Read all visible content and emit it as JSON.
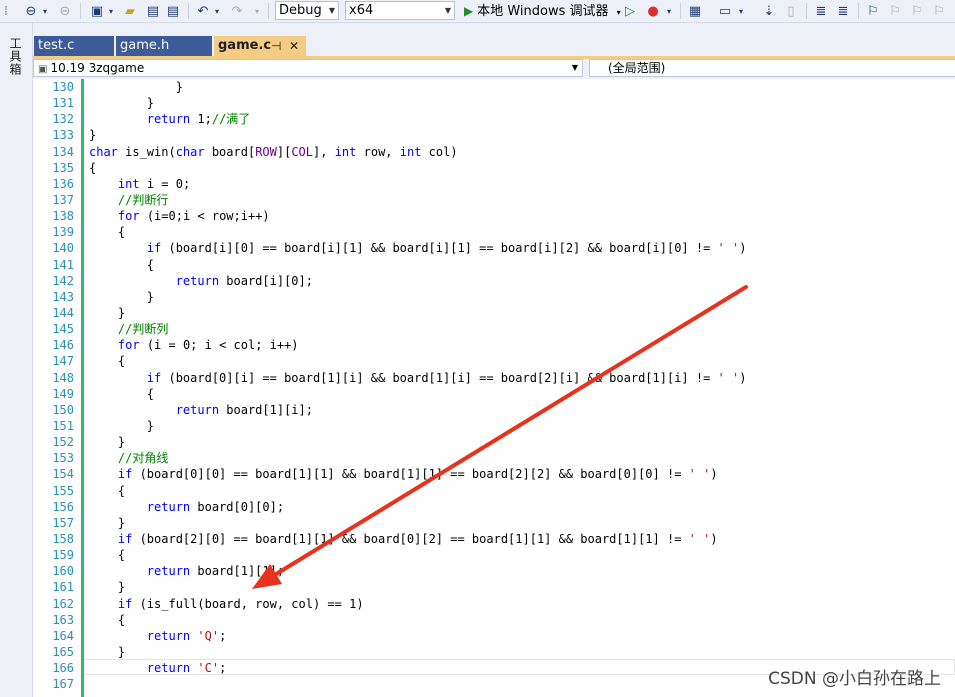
{
  "toolbar": {
    "config": "Debug",
    "platform": "x64",
    "run_label": "本地 Windows 调试器"
  },
  "sidebar": {
    "toolbox_label": "工具箱"
  },
  "tabs": [
    {
      "label": "test.c",
      "active": false
    },
    {
      "label": "game.h",
      "active": false
    },
    {
      "label": "game.c",
      "active": true
    }
  ],
  "nav": {
    "project": "10.19 3zqgame",
    "scope": "(全局范围)"
  },
  "code_lines": [
    {
      "n": "130",
      "t": "            }"
    },
    {
      "n": "131",
      "t": "        }"
    },
    {
      "n": "132",
      "t": "        return 1;//满了"
    },
    {
      "n": "133",
      "t": "}"
    },
    {
      "n": "134",
      "t": "char is_win(char board[ROW][COL], int row, int col)"
    },
    {
      "n": "135",
      "t": "{"
    },
    {
      "n": "136",
      "t": "    int i = 0;"
    },
    {
      "n": "137",
      "t": "    //判断行"
    },
    {
      "n": "138",
      "t": "    for (i=0;i < row;i++)"
    },
    {
      "n": "139",
      "t": "    {"
    },
    {
      "n": "140",
      "t": "        if (board[i][0] == board[i][1] && board[i][1] == board[i][2] && board[i][0] != ' ')"
    },
    {
      "n": "141",
      "t": "        {"
    },
    {
      "n": "142",
      "t": "            return board[i][0];"
    },
    {
      "n": "143",
      "t": "        }"
    },
    {
      "n": "144",
      "t": "    }"
    },
    {
      "n": "145",
      "t": "    //判断列"
    },
    {
      "n": "146",
      "t": "    for (i = 0; i < col; i++)"
    },
    {
      "n": "147",
      "t": "    {"
    },
    {
      "n": "148",
      "t": "        if (board[0][i] == board[1][i] && board[1][i] == board[2][i] && board[1][i] != ' ')"
    },
    {
      "n": "149",
      "t": "        {"
    },
    {
      "n": "150",
      "t": "            return board[1][i];"
    },
    {
      "n": "151",
      "t": "        }"
    },
    {
      "n": "152",
      "t": "    }"
    },
    {
      "n": "153",
      "t": "    //对角线"
    },
    {
      "n": "154",
      "t": "    if (board[0][0] == board[1][1] && board[1][1] == board[2][2] && board[0][0] != ' ')"
    },
    {
      "n": "155",
      "t": "    {"
    },
    {
      "n": "156",
      "t": "        return board[0][0];"
    },
    {
      "n": "157",
      "t": "    }"
    },
    {
      "n": "158",
      "t": "    if (board[2][0] == board[1][1] && board[0][2] == board[1][1] && board[1][1] != ' ')"
    },
    {
      "n": "159",
      "t": "    {"
    },
    {
      "n": "160",
      "t": "        return board[1][1];"
    },
    {
      "n": "161",
      "t": "    }"
    },
    {
      "n": "162",
      "t": "    if (is_full(board, row, col) == 1)"
    },
    {
      "n": "163",
      "t": "    {"
    },
    {
      "n": "164",
      "t": "        return 'Q';"
    },
    {
      "n": "165",
      "t": "    }"
    },
    {
      "n": "166",
      "t": "        return 'C';"
    },
    {
      "n": "167",
      "t": ""
    }
  ],
  "watermark": "CSDN @小白孙在路上",
  "colors": {
    "keyword": "#0000ff",
    "comment": "#008000",
    "string": "#a31515",
    "macro": "#6f008a",
    "line_number": "#2b91af",
    "arrow": "#e8321e"
  }
}
